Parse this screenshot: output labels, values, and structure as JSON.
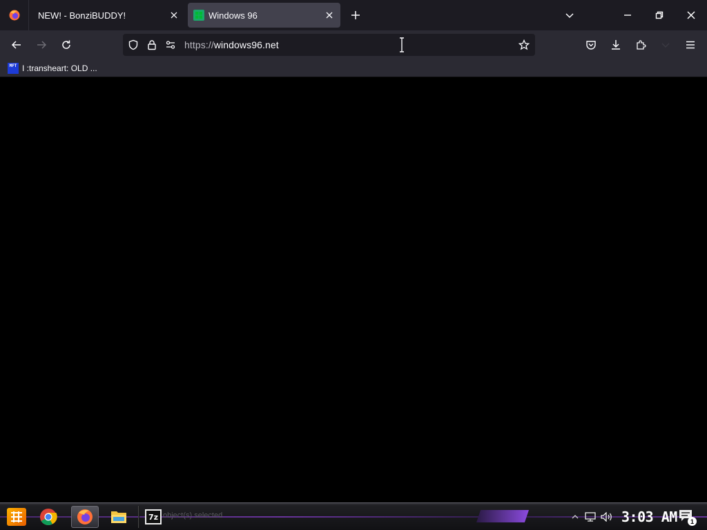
{
  "browser": {
    "tabs": [
      {
        "title": "NEW! - BonziBUDDY!",
        "active": false,
        "favicon": "bonzibuddy-icon"
      },
      {
        "title": "Windows 96",
        "active": true,
        "favicon": "windows96-icon"
      }
    ],
    "url": {
      "protocol": "https://",
      "host": "windows96.net"
    },
    "bookmarks": [
      {
        "label": "I :transheart: OLD ...",
        "icon_text": "MFT"
      }
    ]
  },
  "taskbar": {
    "start_label": "",
    "apps": [
      "chrome-icon",
      "firefox-icon",
      "file-explorer-icon"
    ],
    "sevenzip_label": "7z",
    "status_text": "object(s) selected",
    "clock": "3:03 AM",
    "notification_count": "1"
  },
  "colors": {
    "tab_strip": "#1c1b22",
    "toolbar": "#2b2a33",
    "active_tab": "#42414d",
    "urlbar": "#1c1b22",
    "taskbar_accent": "#8a3fd1"
  }
}
